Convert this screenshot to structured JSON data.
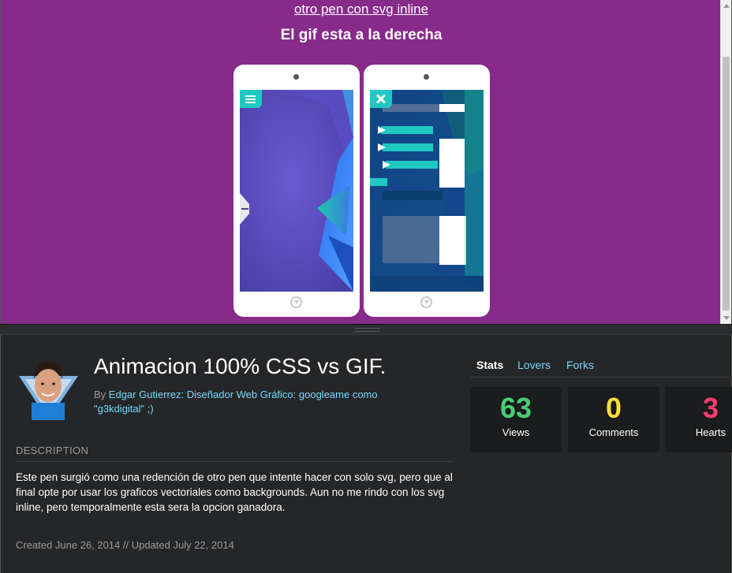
{
  "preview": {
    "link_text": "otro pen con svg inline",
    "caption": "El gif esta a la derecha",
    "background": "#862b8a"
  },
  "pen": {
    "title": "Animacion 100% CSS vs GIF.",
    "by_prefix": "By",
    "author": "Edgar Gutierrez: Diseñador Web Gráfico: googleame como \"g3kdigital\" ;)",
    "description_heading": "DESCRIPTION",
    "description": "Este pen surgió como una redención de otro pen que intente hacer con solo svg, pero que al final opte por usar los graficos vectoriales como backgrounds. Aun no me rindo con los svg inline, pero temporalmente esta sera la opcion ganadora.",
    "dates": "Created June 26, 2014 // Updated July 22, 2014"
  },
  "stats": {
    "tabs": [
      "Stats",
      "Lovers",
      "Forks"
    ],
    "views": {
      "value": "63",
      "label": "Views",
      "color": "#47cf73"
    },
    "comments": {
      "value": "0",
      "label": "Comments",
      "color": "#ffdd40"
    },
    "hearts": {
      "value": "3",
      "label": "Hearts",
      "color": "#ff3c6d"
    }
  },
  "colors": {
    "link": "#76daff",
    "panel": "#252628",
    "accent_teal": "#1fc8c0"
  },
  "icons": [
    "hamburger-menu-icon",
    "close-x-icon",
    "home-button-icon",
    "slide-arrow-icon"
  ]
}
